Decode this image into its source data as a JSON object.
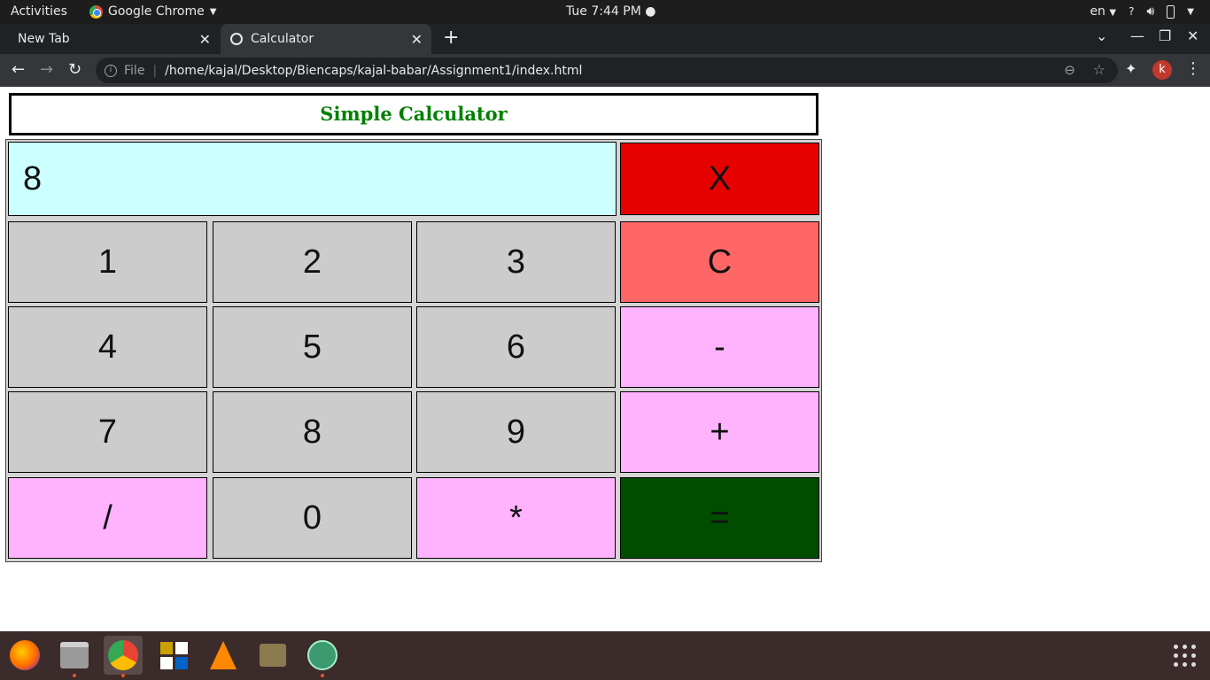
{
  "system_bar": {
    "activities": "Activities",
    "app_name": "Google Chrome",
    "clock": "Tue  7:44 PM",
    "language": "en"
  },
  "browser": {
    "tabs": [
      {
        "label": "New Tab"
      },
      {
        "label": "Calculator"
      }
    ],
    "scheme_label": "File",
    "url": "/home/kajal/Desktop/Biencaps/kajal-babar/Assignment1/index.html",
    "profile_initial": "k"
  },
  "calculator": {
    "title": "Simple Calculator",
    "display_value": "8",
    "clear_label": "X",
    "keys": {
      "k1": "1",
      "k2": "2",
      "k3": "3",
      "c": "C",
      "k4": "4",
      "k5": "5",
      "k6": "6",
      "minus": "-",
      "k7": "7",
      "k8": "8",
      "k9": "9",
      "plus": "+",
      "divide": "/",
      "k0": "0",
      "multiply": "*",
      "equals": "="
    }
  },
  "colors": {
    "title_text": "#008000",
    "display_bg": "#ccffff",
    "number_key_bg": "#cccccc",
    "operator_key_bg": "#ffb3ff",
    "clear_key_bg": "#ff6666",
    "close_key_bg": "#e60000",
    "equals_key_bg": "#004d00"
  },
  "dock": {
    "items": [
      "firefox-icon",
      "files-icon",
      "chrome-icon",
      "office-icon",
      "vlc-icon",
      "search-tool-icon",
      "atom-icon"
    ]
  }
}
